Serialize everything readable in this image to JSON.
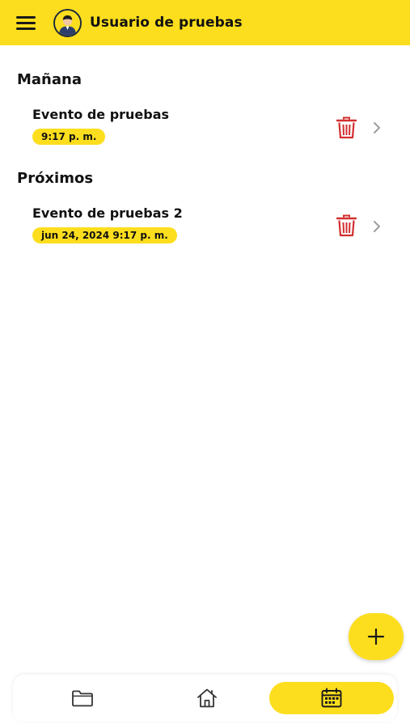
{
  "colors": {
    "accent": "#FDDE1E",
    "danger": "#D32F2F",
    "chevron": "#9E9E9E"
  },
  "header": {
    "title": "Usuario de pruebas",
    "menu_icon": "menu-icon",
    "avatar": "user-avatar"
  },
  "sections": [
    {
      "title": "Mañana",
      "events": [
        {
          "title": "Evento de pruebas",
          "time": "9:17 p. m.",
          "delete_icon": "trash-icon",
          "open_icon": "chevron-right-icon"
        }
      ]
    },
    {
      "title": "Próximos",
      "events": [
        {
          "title": "Evento de pruebas 2",
          "time": "jun 24, 2024 9:17 p. m.",
          "delete_icon": "trash-icon",
          "open_icon": "chevron-right-icon"
        }
      ]
    }
  ],
  "fab": {
    "icon": "plus-icon"
  },
  "bottom_nav": {
    "items": [
      {
        "icon": "folder-icon",
        "active": false
      },
      {
        "icon": "home-icon",
        "active": false
      },
      {
        "icon": "calendar-icon",
        "active": true
      }
    ]
  }
}
